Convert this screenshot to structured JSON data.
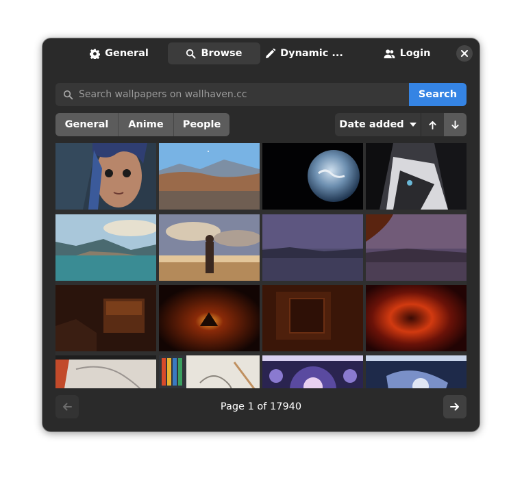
{
  "tabs": [
    {
      "label": "General",
      "icon": "gear-icon"
    },
    {
      "label": "Browse",
      "icon": "search-icon"
    },
    {
      "label": "Dynamic ...",
      "icon": "pencil-icon"
    },
    {
      "label": "Login",
      "icon": "users-icon"
    }
  ],
  "active_tab": "Browse",
  "search": {
    "placeholder": "Search wallpapers on wallhaven.cc",
    "value": "",
    "button_label": "Search"
  },
  "categories": [
    {
      "label": "General",
      "selected": true
    },
    {
      "label": "Anime",
      "selected": true
    },
    {
      "label": "People",
      "selected": true
    }
  ],
  "sort": {
    "label": "Date added",
    "ascending_icon": "arrow-up-icon",
    "descending_icon": "arrow-down-icon",
    "active_direction": "descending"
  },
  "pagination": {
    "label": "Page 1 of 17940",
    "prev_icon": "arrow-left-icon",
    "next_icon": "arrow-right-icon",
    "prev_enabled": false
  },
  "thumbnails": [
    "animated woman with blue hair",
    "mountain landscape with blue sky",
    "planet earth in space",
    "dark anime character",
    "coastal village by the sea",
    "figure on beach at sunset",
    "misty purple lake",
    "misty lake with autumn trees",
    "dark room with wooden chest",
    "dark orange abstract swirl",
    "dark reddish interior",
    "red and black swirl",
    "pencil sketch with colored pencils",
    "drawing of hands with colored pencils",
    "anime girl purple and blue",
    "anime girl in blue light"
  ],
  "colors": {
    "window_bg": "#2a2a2a",
    "accent": "#3584e4",
    "category_bg": "#5c5c5c",
    "control_bg": "#383838"
  }
}
